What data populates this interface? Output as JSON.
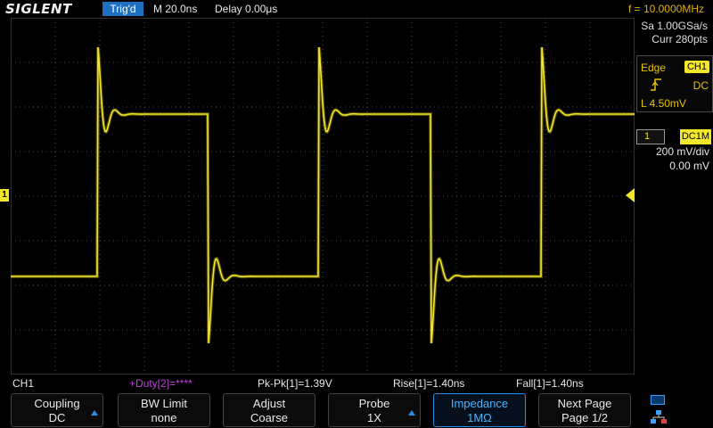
{
  "header": {
    "logo": "SIGLENT",
    "status": "Trig'd",
    "timebase": "M 20.0ns",
    "delay": "Delay 0.00μs",
    "frequency": "f = 10.0000MHz"
  },
  "acquisition": {
    "sample_rate": "Sa 1.00GSa/s",
    "points": "Curr 280pts"
  },
  "trigger": {
    "type": "Edge",
    "source": "CH1",
    "coupling": "DC",
    "level": "L  4.50mV"
  },
  "channel": {
    "number": "1",
    "setting": "DC1M",
    "scale": "200 mV/div",
    "offset": "0.00 mV"
  },
  "measurements": {
    "channel": "CH1",
    "duty": "+Duty[2]=****",
    "pkpk": "Pk-Pk[1]=1.39V",
    "rise": "Rise[1]=1.40ns",
    "fall": "Fall[1]=1.40ns"
  },
  "menu": {
    "coupling": {
      "label": "Coupling",
      "value": "DC"
    },
    "bw_limit": {
      "label": "BW Limit",
      "value": "none"
    },
    "adjust": {
      "label": "Adjust",
      "value": "Coarse"
    },
    "probe": {
      "label": "Probe",
      "value": "1X"
    },
    "impedance": {
      "label": "Impedance",
      "value": "1MΩ"
    },
    "next_page": {
      "label": "Next Page",
      "value": "Page 1/2"
    }
  },
  "colors": {
    "trace": "#f2e72a",
    "accent": "#2a8fe6",
    "measure_duty": "#c040e0",
    "trigger_text": "#e8c300"
  }
}
